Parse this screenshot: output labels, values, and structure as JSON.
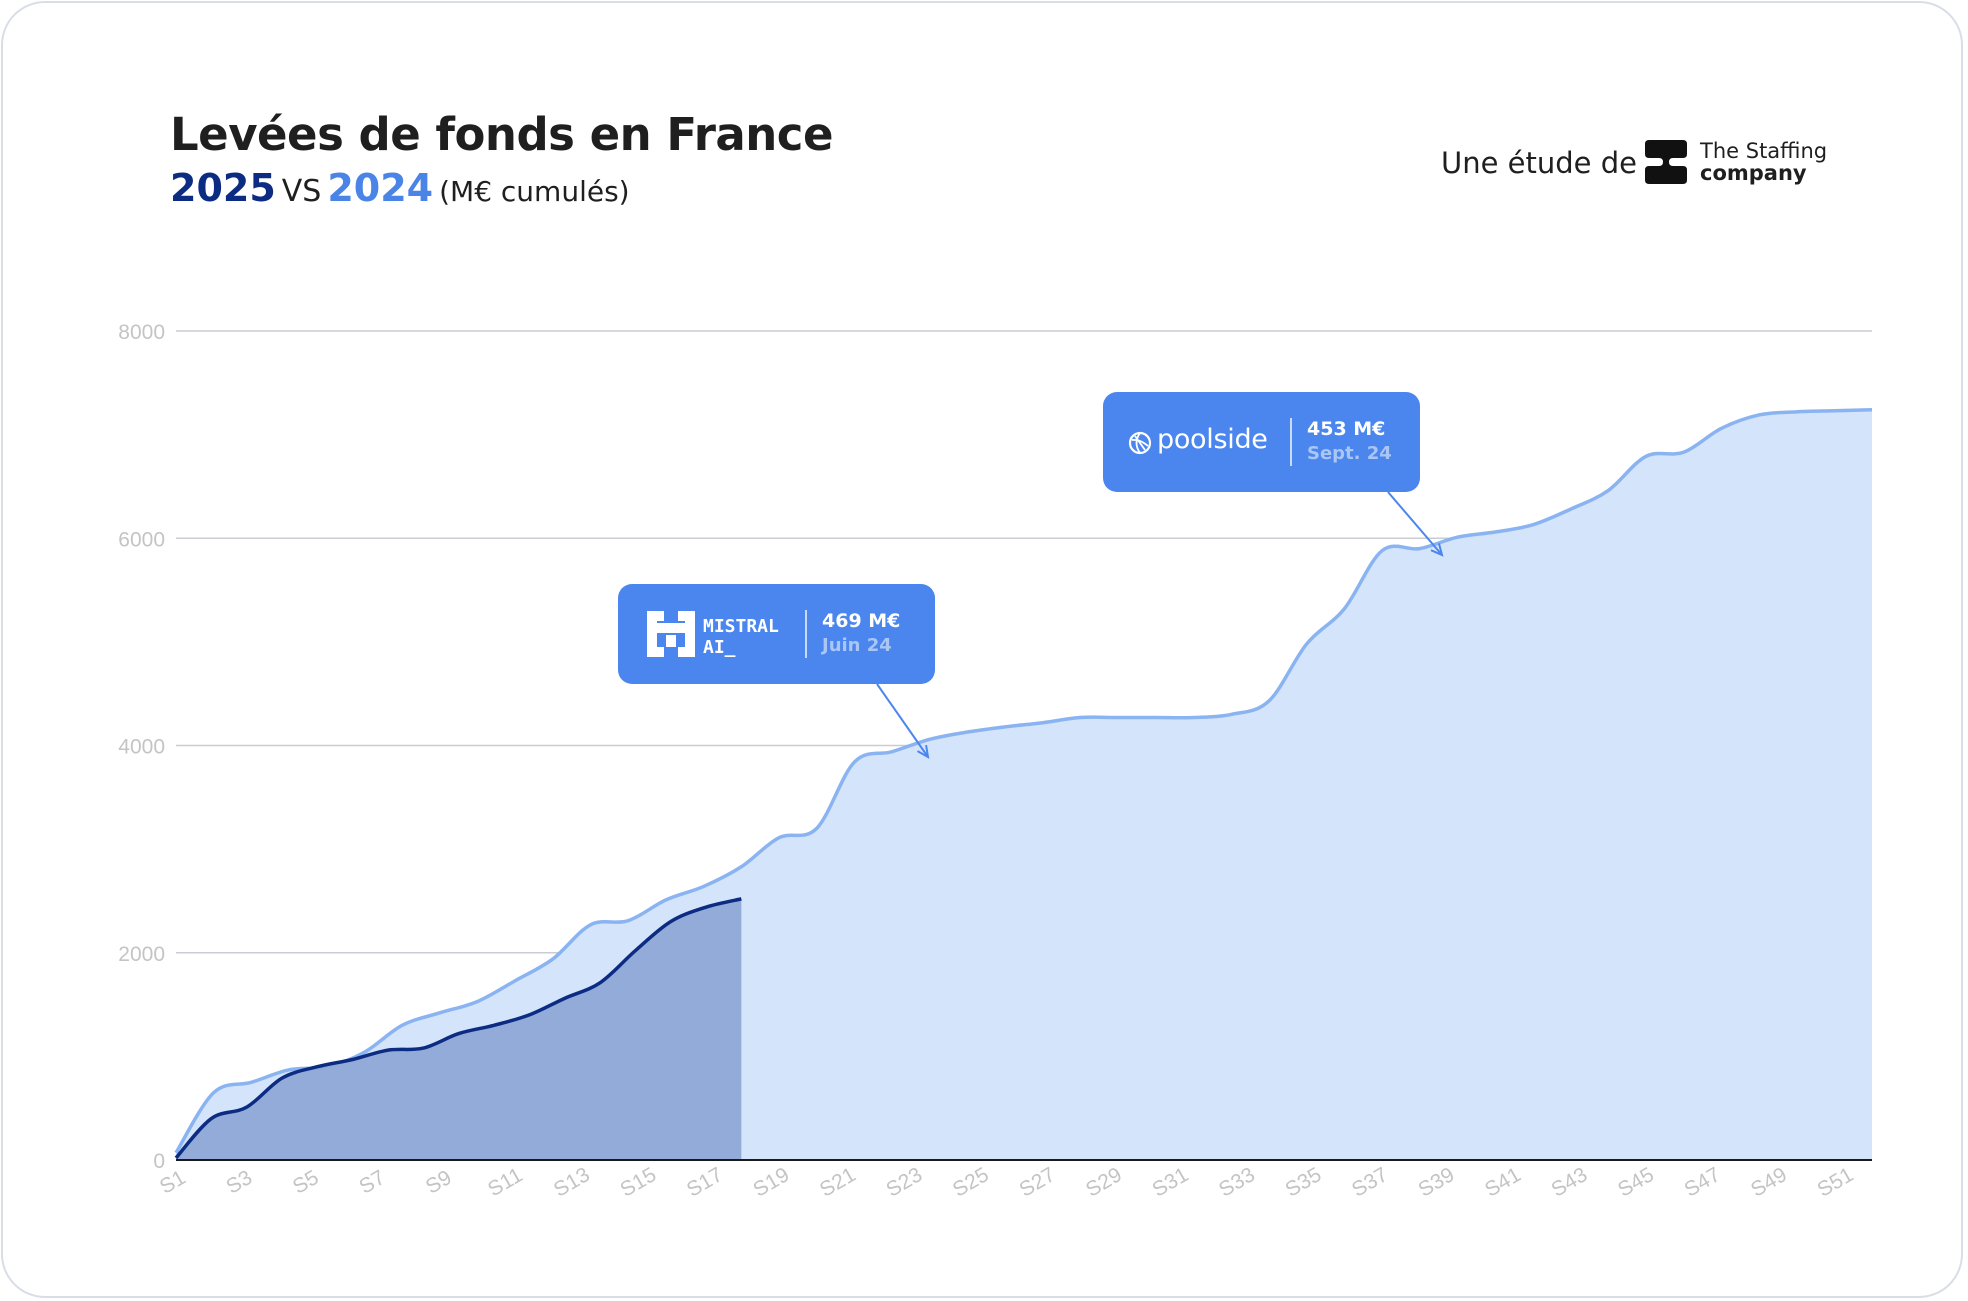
{
  "header": {
    "title": "Levées de fonds en France",
    "year_current": "2025",
    "vs": "VS",
    "year_previous": "2024",
    "unit": "(M€ cumulés)",
    "study_by": "Une étude de",
    "brand_line1": "The Staffing",
    "brand_line2": "company"
  },
  "annotations": [
    {
      "brand": "MISTRAL",
      "brand2": "AI_",
      "amount": "469 M€",
      "date": "Juin 24",
      "icon": "mistral-logo-icon"
    },
    {
      "brand": "poolside",
      "amount": "453 M€",
      "date": "Sept. 24",
      "icon": "poolside-logo-icon"
    }
  ],
  "colors": {
    "series_2025_line": "#0c2c84",
    "series_2025_fill": "#8fa8d6",
    "series_2024_line": "#8ab3f2",
    "series_2024_fill": "#d4e4fa",
    "callout": "#4b86ee",
    "grid": "#c9ccd2",
    "tick": "#c4c4c4"
  },
  "chart_data": {
    "type": "area",
    "title": "Levées de fonds en France",
    "xlabel": "",
    "ylabel": "",
    "ylim": [
      0,
      8000
    ],
    "yticks": [
      0,
      2000,
      4000,
      6000,
      8000
    ],
    "grid": true,
    "x": [
      "S1",
      "S2",
      "S3",
      "S4",
      "S5",
      "S6",
      "S7",
      "S8",
      "S9",
      "S10",
      "S11",
      "S12",
      "S13",
      "S14",
      "S15",
      "S16",
      "S17",
      "S18",
      "S19",
      "S20",
      "S21",
      "S22",
      "S23",
      "S24",
      "S25",
      "S26",
      "S27",
      "S28",
      "S29",
      "S30",
      "S31",
      "S32",
      "S33",
      "S34",
      "S35",
      "S36",
      "S37",
      "S38",
      "S39",
      "S40",
      "S41",
      "S42",
      "S43",
      "S44",
      "S45",
      "S46",
      "S47",
      "S48",
      "S49",
      "S50",
      "S51",
      "S52"
    ],
    "xtick_labels": [
      "S1",
      "S3",
      "S5",
      "S7",
      "S9",
      "S11",
      "S13",
      "S15",
      "S17",
      "S19",
      "S21",
      "S23",
      "S25",
      "S27",
      "S29",
      "S31",
      "S33",
      "S35",
      "S37",
      "S39",
      "S41",
      "S43",
      "S45",
      "S47",
      "S49",
      "S51"
    ],
    "series": [
      {
        "name": "2024",
        "values": [
          70,
          650,
          750,
          870,
          900,
          1040,
          1300,
          1420,
          1530,
          1730,
          1940,
          2270,
          2310,
          2510,
          2640,
          2830,
          3110,
          3200,
          3840,
          3940,
          4060,
          4130,
          4180,
          4220,
          4270,
          4270,
          4270,
          4270,
          4300,
          4430,
          4980,
          5320,
          5880,
          5900,
          6010,
          6060,
          6130,
          6280,
          6460,
          6790,
          6830,
          7060,
          7190,
          7220,
          7230,
          7240
        ]
      },
      {
        "name": "2025",
        "values": [
          20,
          400,
          510,
          790,
          900,
          970,
          1060,
          1080,
          1220,
          1300,
          1400,
          1560,
          1710,
          2020,
          2300,
          2440,
          2520
        ]
      }
    ]
  }
}
